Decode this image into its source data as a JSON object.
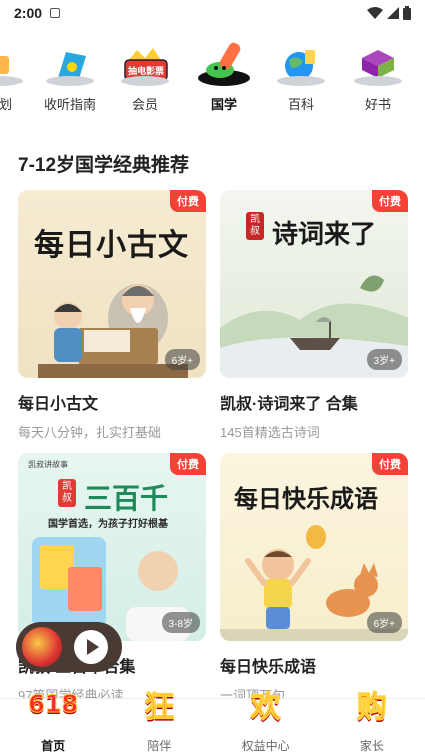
{
  "status_bar": {
    "time": "2:00"
  },
  "category_nav": {
    "items": [
      {
        "label": "计划",
        "icon": "plan-icon",
        "active": false
      },
      {
        "label": "收听指南",
        "icon": "listen-guide-icon",
        "active": false
      },
      {
        "label": "会员",
        "icon": "member-icon",
        "badge": "抽电影票",
        "active": false
      },
      {
        "label": "国学",
        "icon": "sinology-icon",
        "active": true
      },
      {
        "label": "百科",
        "icon": "encyclopedia-icon",
        "active": false
      },
      {
        "label": "好书",
        "icon": "good-books-icon",
        "active": false
      }
    ]
  },
  "section": {
    "title": "7-12岁国学经典推荐"
  },
  "cards": [
    {
      "cover_text": "每日小古文",
      "badge": "付费",
      "age": "6岁+",
      "title": "每日小古文",
      "desc": "每天八分钟，扎实打基础"
    },
    {
      "cover_text": "诗词来了",
      "cover_tag": "凯叔",
      "badge": "付费",
      "age": "3岁+",
      "title": "凯叔·诗词来了 合集",
      "desc": "145首精选古诗词"
    },
    {
      "cover_text": "三百千",
      "cover_tag": "凯叔",
      "cover_sub": "国学首选，为孩子打好根基",
      "cover_brand": "凯叔讲故事",
      "badge": "付费",
      "age": "3-8岁",
      "title": "凯叔·三百千合集",
      "desc": "97篇国学经典必读"
    },
    {
      "cover_text": "每日快乐成语",
      "badge": "付费",
      "age": "6岁+",
      "title": "每日快乐成语",
      "desc": "一词顶万句"
    }
  ],
  "bottom_nav": {
    "items": [
      {
        "label": "首页",
        "festive": "618",
        "active": true
      },
      {
        "label": "陪伴",
        "festive": "狂",
        "active": false
      },
      {
        "label": "权益中心",
        "festive": "欢",
        "active": false
      },
      {
        "label": "家长",
        "festive": "购",
        "active": false
      }
    ]
  },
  "colors": {
    "paid_badge": "#f44336",
    "player_bg": "#4a3a34",
    "festive_red": "#ff2a2a"
  }
}
